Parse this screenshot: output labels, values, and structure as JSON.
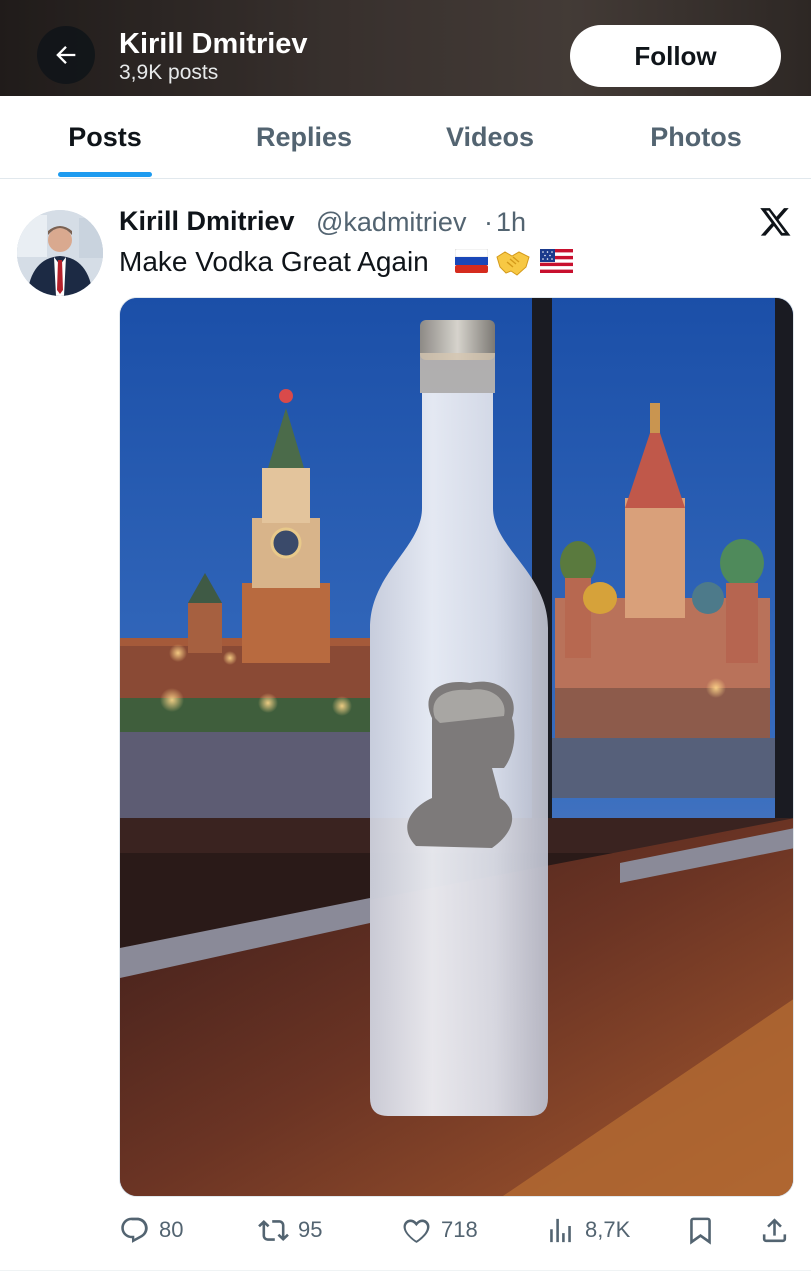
{
  "header": {
    "name": "Kirill Dmitriev",
    "posts_count": "3,9K posts",
    "follow_label": "Follow"
  },
  "tabs": [
    {
      "label": "Posts",
      "active": true
    },
    {
      "label": "Replies",
      "active": false
    },
    {
      "label": "Videos",
      "active": false
    },
    {
      "label": "Photos",
      "active": false
    }
  ],
  "tweet": {
    "author_name": "Kirill Dmitriev",
    "handle": "@kadmitriev",
    "separator": "·",
    "time": "1h",
    "text": "Make Vodka Great Again",
    "emojis": [
      "russia-flag",
      "handshake",
      "usa-flag"
    ],
    "stats": {
      "replies": "80",
      "reposts": "95",
      "likes": "718",
      "views": "8,7K"
    }
  },
  "colors": {
    "accent": "#1d9bf0",
    "secondary_text": "#536471",
    "primary_text": "#0f1419"
  }
}
